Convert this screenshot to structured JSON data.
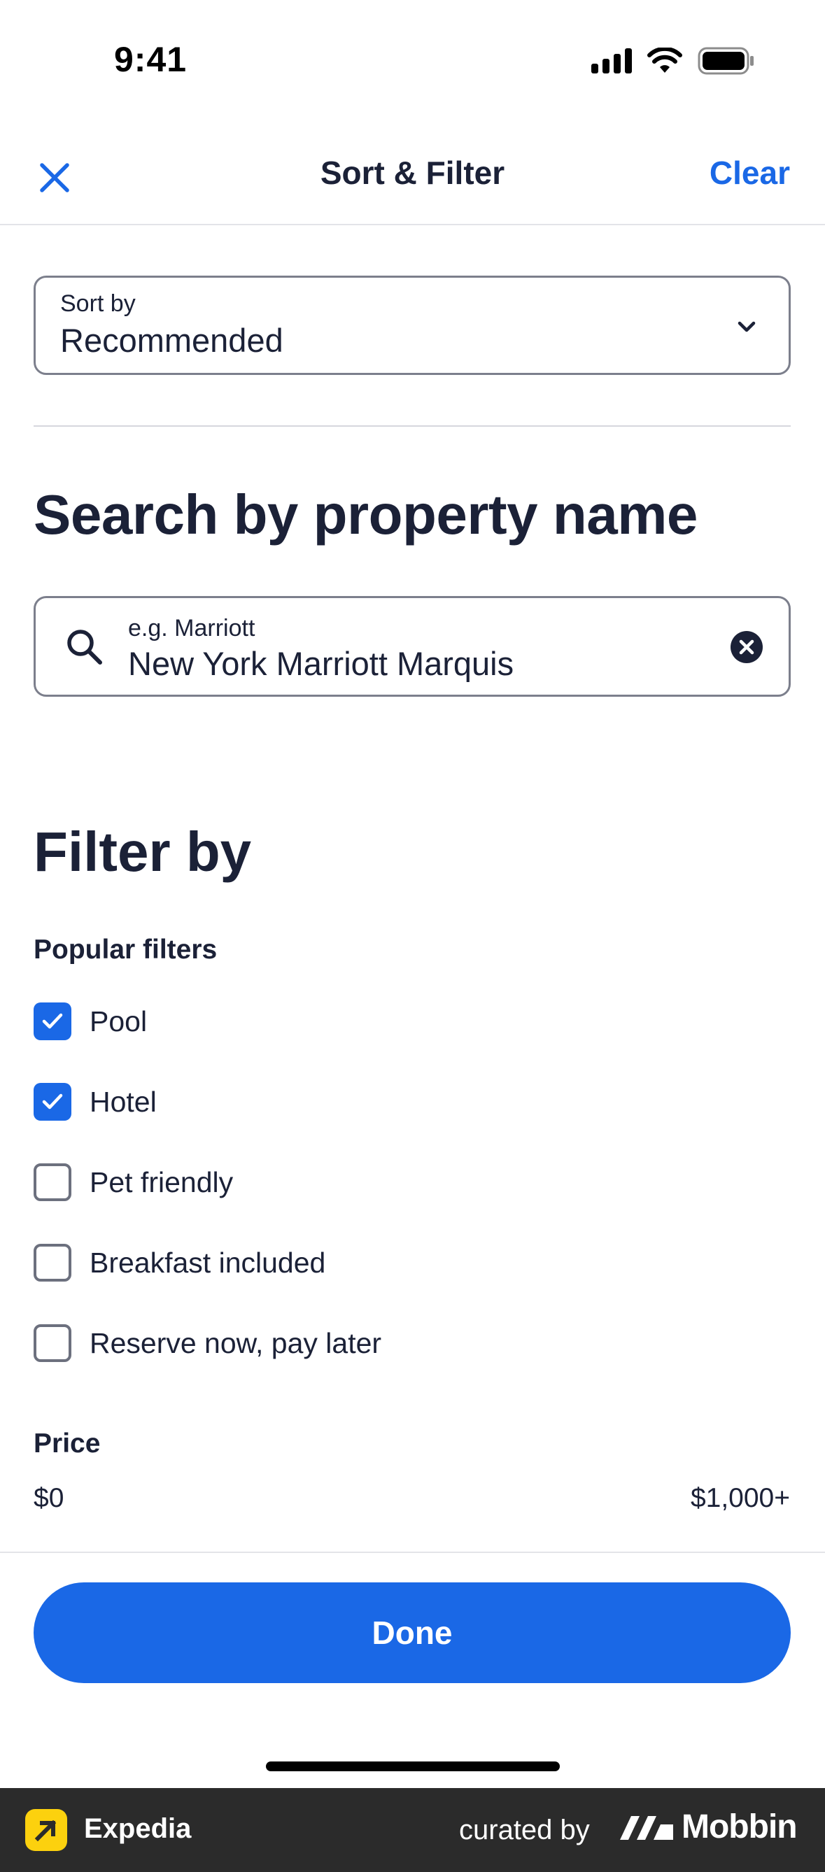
{
  "status_bar": {
    "time": "9:41"
  },
  "header": {
    "title": "Sort & Filter",
    "clear_label": "Clear"
  },
  "sort": {
    "label": "Sort by",
    "value": "Recommended"
  },
  "property_search": {
    "title": "Search by property name",
    "placeholder": "e.g. Marriott",
    "value": "New York Marriott Marquis"
  },
  "filters": {
    "title": "Filter by",
    "popular_title": "Popular filters",
    "items": [
      {
        "label": "Pool",
        "checked": true
      },
      {
        "label": "Hotel",
        "checked": true
      },
      {
        "label": "Pet friendly",
        "checked": false
      },
      {
        "label": "Breakfast included",
        "checked": false
      },
      {
        "label": "Reserve now, pay later",
        "checked": false
      }
    ]
  },
  "price": {
    "title": "Price",
    "min": "$0",
    "max": "$1,000+"
  },
  "footer": {
    "done_label": "Done"
  },
  "brand_bar": {
    "app_name": "Expedia",
    "curated_by": "curated by",
    "curator": "Mobbin"
  },
  "colors": {
    "accent": "#1a68e6",
    "text": "#1b2137",
    "brand_yellow": "#fcd10e"
  }
}
